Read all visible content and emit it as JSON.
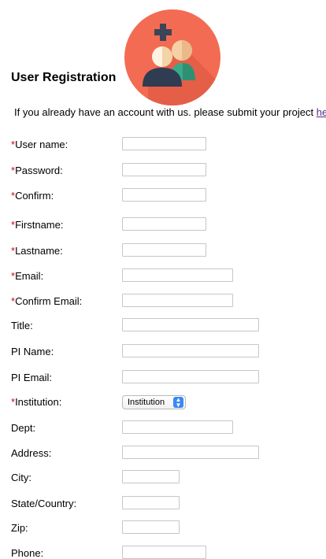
{
  "header": {
    "title": "User Registration",
    "intro_text": "If you already have an account with us. please submit your project ",
    "intro_link": "here",
    "logo": "user-group-add-icon",
    "colors": {
      "logo_bg": "#f36b53",
      "required_star": "#d0021b",
      "link": "#5b2a86"
    }
  },
  "form": {
    "required_mark": "*",
    "fields": [
      {
        "label": "User name:",
        "required": true,
        "value": ""
      },
      {
        "label": "Password:",
        "required": true,
        "value": ""
      },
      {
        "label": "Confirm:",
        "required": true,
        "value": ""
      },
      {
        "label": "Firstname:",
        "required": true,
        "value": ""
      },
      {
        "label": "Lastname:",
        "required": true,
        "value": ""
      },
      {
        "label": "Email:",
        "required": true,
        "value": ""
      },
      {
        "label": "Confirm Email:",
        "required": true,
        "value": ""
      },
      {
        "label": "Title:",
        "required": false,
        "value": ""
      },
      {
        "label": "PI Name:",
        "required": false,
        "value": ""
      },
      {
        "label": "PI Email:",
        "required": false,
        "value": ""
      },
      {
        "label": "Institution:",
        "required": true,
        "selected": "Institution"
      },
      {
        "label": "Dept:",
        "required": false,
        "value": ""
      },
      {
        "label": "Address:",
        "required": false,
        "value": ""
      },
      {
        "label": "City:",
        "required": false,
        "value": ""
      },
      {
        "label": "State/Country:",
        "required": false,
        "value": ""
      },
      {
        "label": "Zip:",
        "required": false,
        "value": ""
      },
      {
        "label": "Phone:",
        "required": false,
        "value": ""
      }
    ]
  }
}
